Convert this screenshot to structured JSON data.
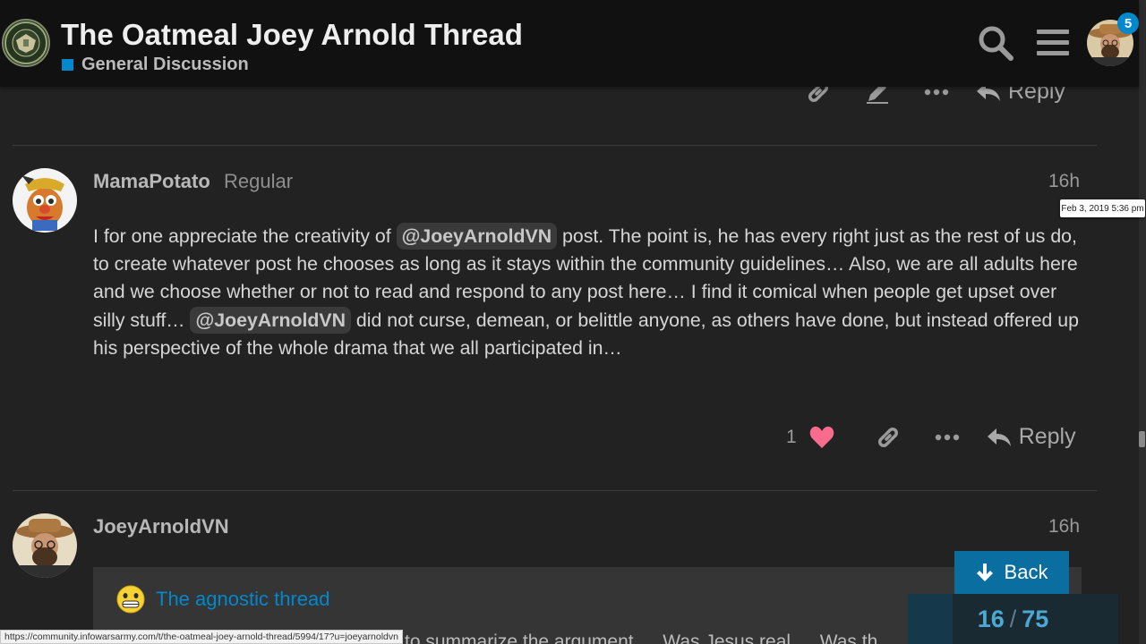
{
  "header": {
    "title": "The Oatmeal Joey Arnold Thread",
    "category": "General Discussion",
    "category_color": "#0088cc",
    "notification_count": "5",
    "icons": [
      "search-icon",
      "hamburger-menu-icon",
      "user-avatar"
    ]
  },
  "top_controls": {
    "reply_label": "Reply",
    "icons": [
      "link-icon",
      "edit-icon",
      "more-icon"
    ]
  },
  "post1": {
    "username": "MamaPotato",
    "user_title": "Regular",
    "time": "16h",
    "tooltip": "Feb 3, 2019 5:36 pm",
    "body_a": "I for one appreciate the creativity of ",
    "mention": "@JoeyArnoldVN",
    "body_b": " post. The point is, he has every right just as the rest of us do, to create whatever post he chooses as long as it stays within the community guidelines… Also, we are all adults here and we choose whether or not to read and respond to any post here… I find it comical when people get upset over silly stuff… ",
    "body_c": " did not curse, demean, or belittle anyone, as others have done, but instead offered up his perspective of the whole drama that we all participated in…",
    "like_count": "1",
    "reply_label": "Reply"
  },
  "post2": {
    "username": "JoeyArnoldVN",
    "time": "16h",
    "quote_title": "The agnostic thread",
    "partial_text": "to summarize the argument … Was Jesus real … Was th"
  },
  "nav": {
    "back_label": "Back",
    "current": "16",
    "separator": "/",
    "total": "75",
    "progress_fraction": 0.2133
  },
  "status_bar": {
    "url": "https://community.infowarsarmy.com/t/the-oatmeal-joey-arnold-thread/5994/17?u=joeyarnoldvn"
  },
  "colors": {
    "accent": "#0088cc",
    "like_heart": "#fa6c8d",
    "background": "#222222"
  }
}
